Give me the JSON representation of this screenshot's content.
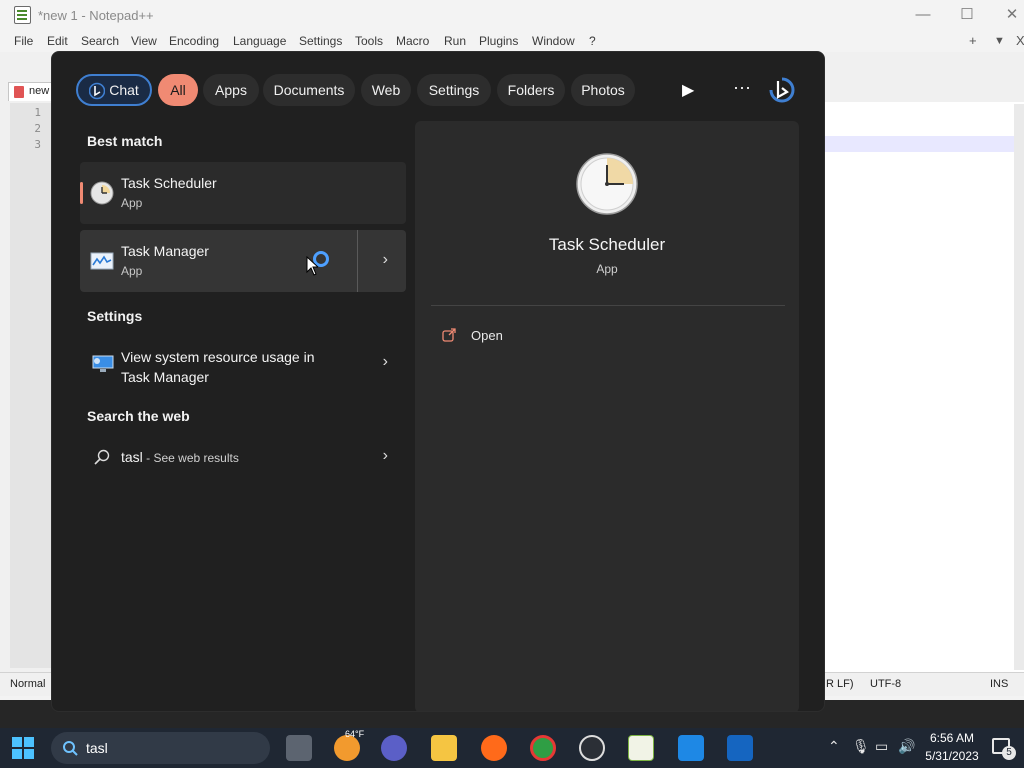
{
  "notepad": {
    "title": "*new 1 - Notepad++",
    "menu": [
      "File",
      "Edit",
      "Search",
      "View",
      "Encoding",
      "Language",
      "Settings",
      "Tools",
      "Macro",
      "Run",
      "Plugins",
      "Window",
      "?"
    ],
    "menu_right": [
      "+",
      "▼",
      "X"
    ],
    "tab_label": "new",
    "line_numbers": [
      "1",
      "2",
      "3"
    ],
    "status": {
      "mode": "Normal",
      "eol": "R LF)",
      "encoding": "UTF-8",
      "insert": "INS"
    }
  },
  "flyout": {
    "filters": [
      {
        "label": "Chat"
      },
      {
        "label": "All"
      },
      {
        "label": "Apps"
      },
      {
        "label": "Documents"
      },
      {
        "label": "Web"
      },
      {
        "label": "Settings"
      },
      {
        "label": "Folders"
      },
      {
        "label": "Photos"
      }
    ],
    "active_filter": "All",
    "best_match_heading": "Best match",
    "results": [
      {
        "title": "Task Scheduler",
        "subtitle": "App",
        "icon": "clock-icon"
      },
      {
        "title": "Task Manager",
        "subtitle": "App",
        "icon": "task-manager-icon"
      }
    ],
    "settings_heading": "Settings",
    "settings_item": {
      "line1": "View system resource usage in",
      "line2": "Task Manager",
      "icon": "monitor-settings-icon"
    },
    "web_heading": "Search the web",
    "web_item": {
      "query": "tasl",
      "suffix": " - See web results",
      "icon": "search-icon"
    },
    "detail": {
      "title": "Task Scheduler",
      "subtitle": "App",
      "actions": [
        {
          "label": "Open",
          "icon": "open-external-icon"
        }
      ]
    }
  },
  "taskbar": {
    "search_value": "tasl",
    "weather_temp": "64°F",
    "time": "6:56 AM",
    "date": "5/31/2023",
    "notification_count": "5",
    "colors": {
      "taskbar": "#1f2733",
      "accent": "#f08a73",
      "bing": "#3f7fd1"
    }
  }
}
